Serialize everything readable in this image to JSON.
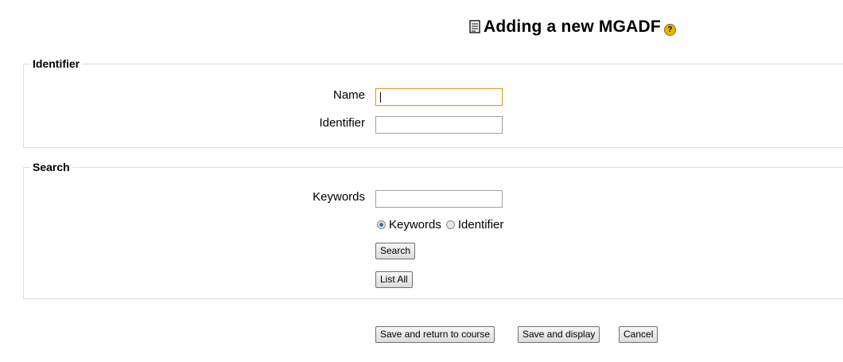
{
  "page": {
    "title": "Adding a new MGADF",
    "help_icon_glyph": "?"
  },
  "identifier_section": {
    "legend": "Identifier",
    "name_label": "Name",
    "name_value": "",
    "identifier_label": "Identifier",
    "identifier_value": ""
  },
  "search_section": {
    "legend": "Search",
    "keywords_label": "Keywords",
    "keywords_value": "",
    "radio_options": [
      {
        "label": "Keywords",
        "checked": true
      },
      {
        "label": "Identifier",
        "checked": false
      }
    ],
    "search_button": "Search",
    "list_all_button": "List All"
  },
  "actions": {
    "save_return": "Save and return to course",
    "save_display": "Save and display",
    "cancel": "Cancel"
  },
  "colors": {
    "focus_border": "#e0a020",
    "help_icon": "#e8b400",
    "radio_selected": "#3a6ea5"
  },
  "icons": {
    "title_icon": "document-icon",
    "help": "help-icon"
  }
}
